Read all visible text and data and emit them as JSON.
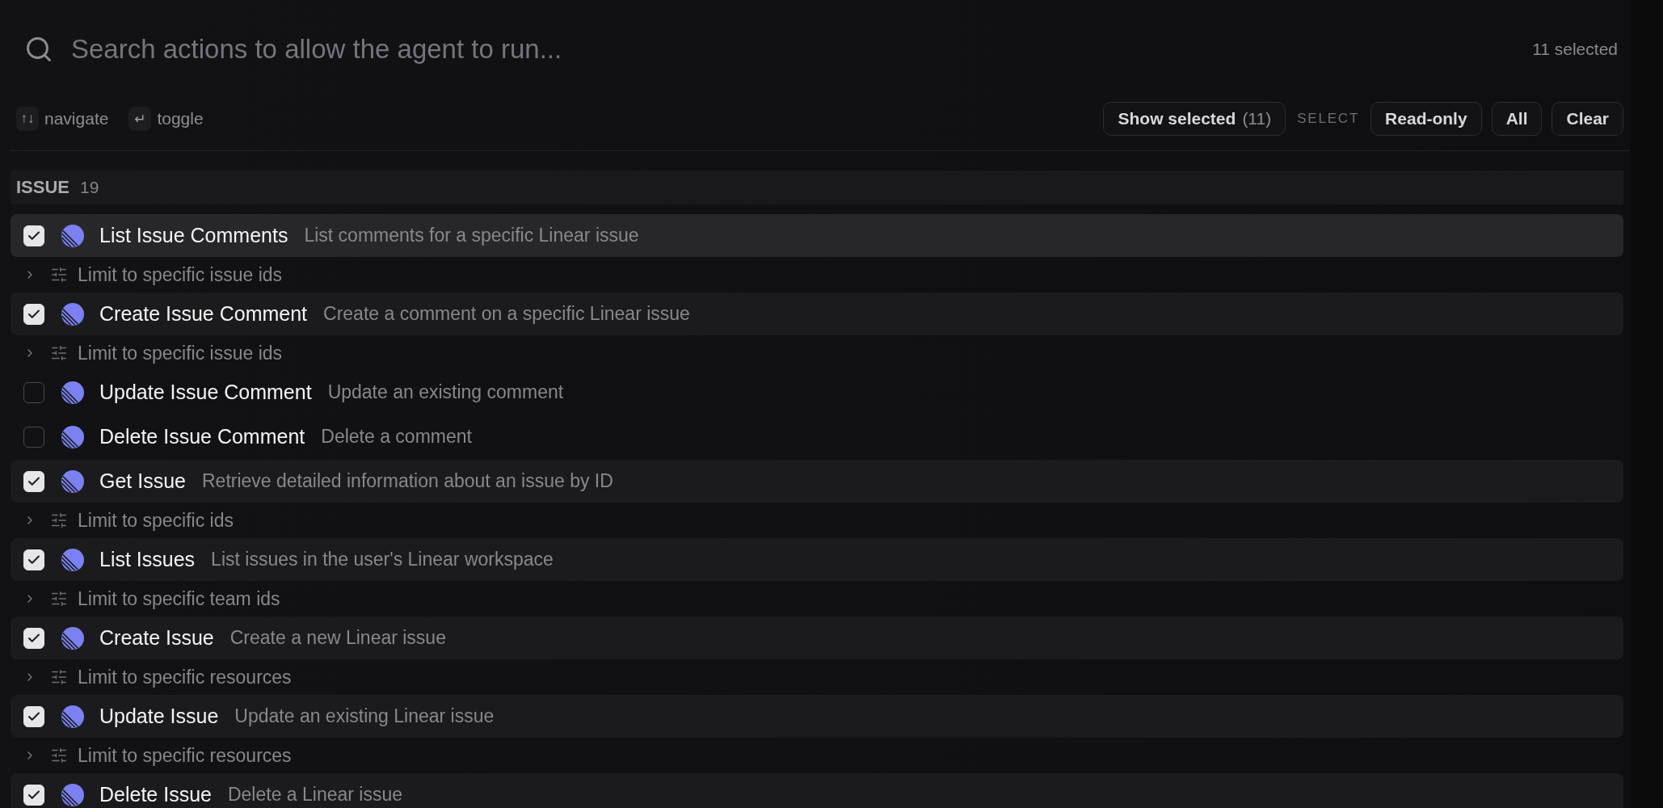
{
  "search": {
    "placeholder": "Search actions to allow the agent to run...",
    "selected_count": "11 selected"
  },
  "hints": [
    {
      "key": "↑↓",
      "label": "navigate"
    },
    {
      "key": "↵",
      "label": "toggle"
    }
  ],
  "toolbar": {
    "show_selected": {
      "label": "Show selected",
      "count": "(11)"
    },
    "select_label": "SELECT",
    "buttons": [
      "Read-only",
      "All",
      "Clear"
    ]
  },
  "groups": [
    {
      "title": "ISSUE",
      "count": "19",
      "actions": [
        {
          "name": "List Issue Comments",
          "description": "List comments for a specific Linear issue",
          "checked": true,
          "focused": true,
          "limit": {
            "label": "Limit to specific issue ids",
            "expanded": false
          }
        },
        {
          "name": "Create Issue Comment",
          "description": "Create a comment on a specific Linear issue",
          "checked": true,
          "focused": false,
          "limit": {
            "label": "Limit to specific issue ids",
            "expanded": false
          }
        },
        {
          "name": "Update Issue Comment",
          "description": "Update an existing comment",
          "checked": false,
          "focused": false
        },
        {
          "name": "Delete Issue Comment",
          "description": "Delete a comment",
          "checked": false,
          "focused": false
        },
        {
          "name": "Get Issue",
          "description": "Retrieve detailed information about an issue by ID",
          "checked": true,
          "focused": false,
          "limit": {
            "label": "Limit to specific ids",
            "expanded": false
          }
        },
        {
          "name": "List Issues",
          "description": "List issues in the user's Linear workspace",
          "checked": true,
          "focused": false,
          "limit": {
            "label": "Limit to specific team ids",
            "expanded": false
          }
        },
        {
          "name": "Create Issue",
          "description": "Create a new Linear issue",
          "checked": true,
          "focused": false,
          "limit": {
            "label": "Limit to specific resources",
            "expanded": false
          }
        },
        {
          "name": "Update Issue",
          "description": "Update an existing Linear issue",
          "checked": true,
          "focused": false,
          "limit": {
            "label": "Limit to specific resources",
            "expanded": false
          }
        },
        {
          "name": "Delete Issue",
          "description": "Delete a Linear issue",
          "checked": true,
          "focused": false
        }
      ]
    }
  ]
}
